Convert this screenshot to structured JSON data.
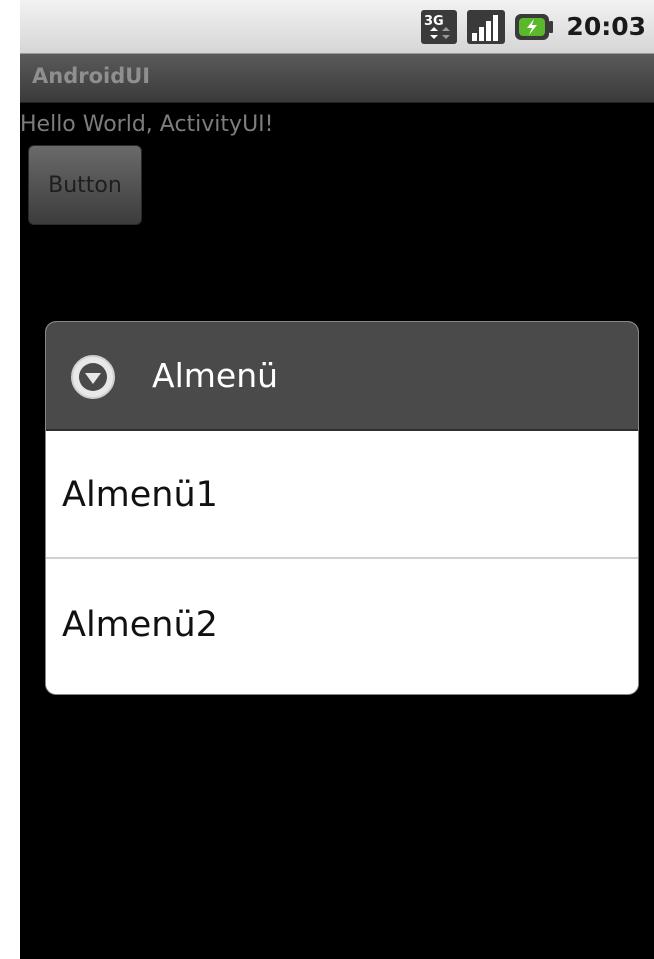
{
  "status_bar": {
    "network_icon": "3g-data-icon",
    "signal_icon": "signal-strength-icon",
    "battery_icon": "battery-charging-icon",
    "time": "20:03"
  },
  "title_bar": {
    "title": "AndroidUI"
  },
  "content": {
    "hello_text": "Hello World, ActivityUI!",
    "button_label": "Button"
  },
  "dialog": {
    "icon": "dropdown-circle-icon",
    "title": "Almenü",
    "items": [
      {
        "label": "Almenü1"
      },
      {
        "label": "Almenü2"
      }
    ]
  },
  "colors": {
    "background": "#000000",
    "status_bar": "#e0e0e0",
    "title_bar": "#474747",
    "dialog_header": "#4a4a4a",
    "dialog_body": "#ffffff",
    "hello_text": "#7d7d7d"
  }
}
